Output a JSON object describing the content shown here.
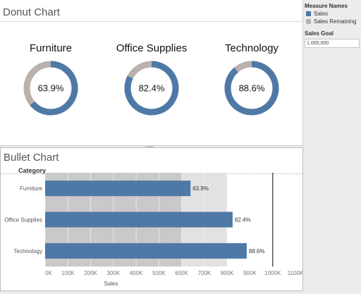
{
  "donut_sheet": {
    "title": "Donut Chart",
    "donuts": [
      {
        "name": "Furniture",
        "pct_label": "63.9%",
        "fraction": 0.639
      },
      {
        "name": "Office Supplies",
        "pct_label": "82.4%",
        "fraction": 0.824
      },
      {
        "name": "Technology",
        "pct_label": "88.6%",
        "fraction": 0.886
      }
    ]
  },
  "bullet_sheet": {
    "title": "Bullet Chart",
    "category_header": "Category"
  },
  "legend": {
    "title": "Measure Names",
    "items": [
      {
        "label": "Sales",
        "color": "#4e79a7"
      },
      {
        "label": "Sales Remaining",
        "color": "#bab0ac"
      }
    ]
  },
  "parameter": {
    "label": "Sales Goal",
    "value": "1,000,000"
  },
  "colors": {
    "sales": "#4e79a7",
    "remaining": "#bab0ac",
    "band_dark": "#c9c9c9",
    "band_light": "#e2e2e2",
    "goal_line": "#555555"
  },
  "chart_data": [
    {
      "type": "pie",
      "title": "Furniture",
      "slices": [
        {
          "name": "Sales",
          "value": 63.9
        },
        {
          "name": "Sales Remaining",
          "value": 36.1
        }
      ],
      "center_label": "63.9%"
    },
    {
      "type": "pie",
      "title": "Office Supplies",
      "slices": [
        {
          "name": "Sales",
          "value": 82.4
        },
        {
          "name": "Sales Remaining",
          "value": 17.6
        }
      ],
      "center_label": "82.4%"
    },
    {
      "type": "pie",
      "title": "Technology",
      "slices": [
        {
          "name": "Sales",
          "value": 88.6
        },
        {
          "name": "Sales Remaining",
          "value": 11.4
        }
      ],
      "center_label": "88.6%"
    },
    {
      "type": "bar",
      "orientation": "horizontal",
      "title": "Bullet Chart",
      "categories": [
        "Furniture",
        "Office Supplies",
        "Technology"
      ],
      "values": [
        639000,
        824000,
        886000
      ],
      "value_labels": [
        "63.9%",
        "82.4%",
        "88.6%"
      ],
      "xlabel": "Sales",
      "ylabel": "Category",
      "xlim": [
        0,
        1100000
      ],
      "xticks": [
        0,
        100000,
        200000,
        300000,
        400000,
        500000,
        600000,
        700000,
        800000,
        900000,
        1000000,
        1100000
      ],
      "xtick_labels": [
        "0K",
        "100K",
        "200K",
        "300K",
        "400K",
        "500K",
        "600K",
        "700K",
        "800K",
        "900K",
        "1000K",
        "1100K"
      ],
      "reference_line": 1000000,
      "bands": [
        {
          "from": 0,
          "to": 600000,
          "shade": "dark"
        },
        {
          "from": 600000,
          "to": 800000,
          "shade": "light"
        }
      ]
    }
  ]
}
